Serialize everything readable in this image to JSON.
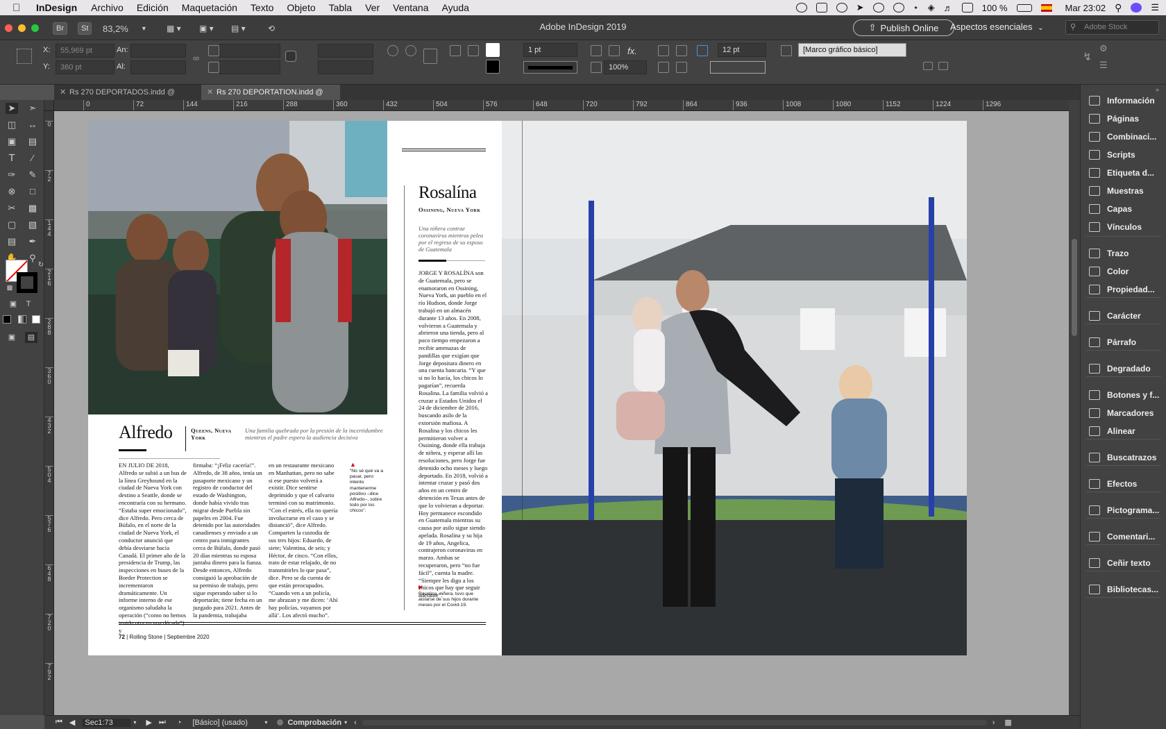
{
  "menubar": {
    "app": "InDesign",
    "items": [
      "Archivo",
      "Edición",
      "Maquetación",
      "Texto",
      "Objeto",
      "Tabla",
      "Ver",
      "Ventana",
      "Ayuda"
    ],
    "battery": "100 %",
    "clock": "Mar 23:02"
  },
  "titlebar": {
    "br": "Br",
    "st": "St",
    "zoom": "83,2%",
    "title": "Adobe InDesign 2019",
    "publish": "Publish Online",
    "workspace": "Aspectos esenciales",
    "stock_placeholder": "Adobe Stock"
  },
  "control": {
    "x_label": "X:",
    "x_value": "55,969 pt",
    "y_label": "Y:",
    "y_value": "360 pt",
    "w_label": "An:",
    "h_label": "Al:",
    "stroke_weight": "1 pt",
    "scale": "100%",
    "gap": "12 pt",
    "object_style": "[Marco gráfico básico]"
  },
  "tabs": [
    {
      "label": "Rs 270 DEPORTADOS.indd @ 83%",
      "active": false
    },
    {
      "label": "Rs 270 DEPORTATION.indd @ 83%",
      "active": true
    }
  ],
  "ruler_h": [
    "0",
    "72",
    "144",
    "216",
    "288",
    "360",
    "432",
    "504",
    "576",
    "648",
    "720",
    "792",
    "864",
    "936",
    "1008",
    "1080",
    "1152",
    "1224",
    "1296"
  ],
  "ruler_v": [
    "0",
    "72",
    "144",
    "216",
    "288",
    "360",
    "432",
    "504",
    "576",
    "648",
    "720",
    "792"
  ],
  "article": {
    "alfredo": {
      "name": "Alfredo",
      "place": "Queens, Nueva York",
      "deck": "Una familia quebrada por la presión de la incertidumbre mientras el padre espera la audiencia decisiva",
      "col1": "EN JULIO DE 2018, Alfredo se subió a un bus de la línea Greyhound en la ciudad de Nueva York con destino a Seattle, donde se encontraría con su hermano. “Estaba super emocionado”, dice Alfredo. Pero cerca de Búfalo, en el norte de la ciudad de Nueva York, el conductor anunció que debía desviarse hacia Canadá. El primer año de la presidencia de Trump, las inspecciones en buses de la Border Protection se incrementaron dramáticamente. Un informe interno de ese organismo saludaba la operación (“como no hemos tenido otra en una década”) y",
      "col2": "firmaba: “¡Feliz cacería!”. Alfredo, de 38 años, tenía un pasaporte mexicano y un registro de conductor del estado de Washington, donde había vivido tras migrar desde Puebla sin papeles en 2004. Fue detenido por las autoridades canadienses y enviado a un centro para inmigrantes cerca de Búfalo, donde pasó 20 días mientras su esposa juntaba dinero para la fianza. Desde entonces, Alfredo consiguió la aprobación de su permiso de trabajo, pero sigue esperando saber si lo deportarán; tiene fecha en un juzgado para 2021. Antes de la pandemia, trabajaba",
      "col3": "en un restaurante mexicano en Manhattan, pero no sabe si ese puesto volverá a existir. Dice sentirse deprimido y que el calvario terminó con su matrimonio. “Con el estrés, ella no quería involucrarse en el caso y se distanció”, dice Alfredo. Comparten la custodia de sus tres hijos: Eduardo, de siete; Valentina, de seis; y Héctor, de cinco. “Con ellos, trato de estar relajado, de no transmitirles lo que pasa”, dice. Pero se da cuenta de que están preocupados. “Cuando ven a un policía, me abrazan y me dicen: ‘Ahí hay policías, vayamos por allá’. Los afectó mucho”.",
      "caption": "“No sé qué va a pasar, pero intento mantenerme positivo –dice Alfredo–, sobre todo por los chicos”."
    },
    "rosalina": {
      "name": "Rosalína",
      "place": "Ossining, Nueva York",
      "deck": "Una niñera contrae coronavirus mientras pelea por el regreso de su esposo de Guatemala",
      "body": "JORGE Y ROSALÍNA son de Guatemala, pero se enamoraron en Ossining, Nueva York, un pueblo en el río Hudson, donde Jorge trabajó en un almacén durante 13 años. En 2008, volvieron a Guatemala y abrieron una tienda, pero al poco tiempo empezaron a recibir amenazas de pandillas que exigían que Jorge depositara dinero en una cuenta bancaria. “Y que si no lo hacía, los chicos lo pagarían”, recuerda Rosalina. La familia volvió a cruzar a Estados Unidos el 24 de diciembre de 2016, buscando asilo de la extorsión mafiosa. A Rosalina y los chicos les permitieron volver a Ossining, donde ella trabaja de niñera, y esperar allí las resoluciones, pero Jorge fue detenido ocho meses y luego deportado. En 2018, volvió a intentar cruzar y pasó dos años en un centro de detención en Texas antes de que lo volvieran a deportar. Hoy permanece escondido en Guatemala mientras su causa por asilo sigue siendo apelada. Rosalina y su hija de 19 años, Angelica, contrajeron coronavirus en marzo. Ambas se recuperaron, pero “no fue fácil”, cuenta la madre. “Siempre les digo a los chicos que hay que seguir adelante”.",
      "caption": "Rosalina, niñera, tuvo que aislarse de sus hijos durante meses por el Covid-19."
    },
    "folio": {
      "page": "72",
      "magazine": "Rolling Stone",
      "date": "Septiembre 2020"
    }
  },
  "panel": [
    "Información",
    "Páginas",
    "Combinaci...",
    "Scripts",
    "Etiqueta d...",
    "Muestras",
    "Capas",
    "Vínculos",
    "Trazo",
    "Color",
    "Propiedad...",
    "Carácter",
    "Párrafo",
    "Degradado",
    "Botones y f...",
    "Marcadores",
    "Alinear",
    "Buscatrazos",
    "Efectos",
    "Pictograma...",
    "Comentari...",
    "Ceñir texto",
    "Bibliotecas..."
  ],
  "statusbar": {
    "page": "Sec1:73",
    "style": "[Básico] (usado)",
    "preflight": "Comprobación"
  }
}
